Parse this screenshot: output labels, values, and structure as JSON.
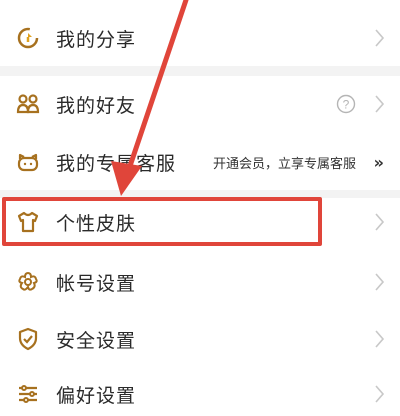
{
  "menu": {
    "share": {
      "label": "我的分享",
      "icon": "share-icon"
    },
    "friends": {
      "label": "我的好友",
      "icon": "friends-icon",
      "help": "help-icon"
    },
    "service": {
      "label": "我的专属客服",
      "icon": "service-icon",
      "promo": "开通会员，立享专属客服",
      "more": "»"
    },
    "skin": {
      "label": "个性皮肤",
      "icon": "tshirt-icon"
    },
    "account": {
      "label": "帐号设置",
      "icon": "flower-icon"
    },
    "security": {
      "label": "安全设置",
      "icon": "shield-icon"
    },
    "preference": {
      "label": "偏好设置",
      "icon": "sliders-icon"
    }
  },
  "colors": {
    "icon": "#a7711f",
    "highlight": "#e0453a",
    "divider": "#f3f3f3"
  }
}
